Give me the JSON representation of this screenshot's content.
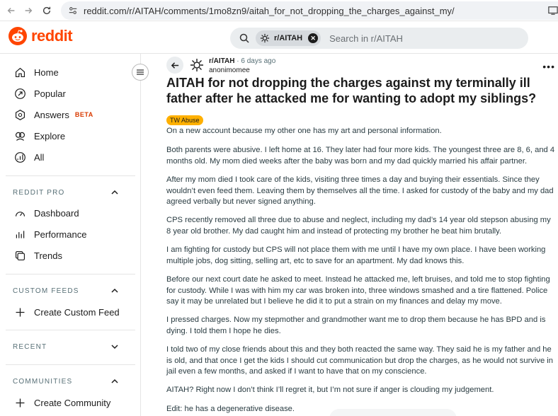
{
  "browser": {
    "url": "reddit.com/r/AITAH/comments/1mo8zn9/aitah_for_not_dropping_the_charges_against_my/"
  },
  "header": {
    "logo_text": "reddit",
    "search_chip": "r/AITAH",
    "search_placeholder": "Search in r/AITAH"
  },
  "sidebar": {
    "main_items": [
      {
        "label": "Home",
        "icon": "home-icon"
      },
      {
        "label": "Popular",
        "icon": "popular-icon"
      },
      {
        "label": "Answers",
        "icon": "answers-icon",
        "badge": "BETA"
      },
      {
        "label": "Explore",
        "icon": "explore-icon"
      },
      {
        "label": "All",
        "icon": "all-icon"
      }
    ],
    "reddit_pro": {
      "title": "REDDIT PRO",
      "items": [
        {
          "label": "Dashboard",
          "icon": "dashboard-icon"
        },
        {
          "label": "Performance",
          "icon": "performance-icon"
        },
        {
          "label": "Trends",
          "icon": "trends-icon"
        }
      ]
    },
    "custom_feeds": {
      "title": "CUSTOM FEEDS",
      "create_label": "Create Custom Feed"
    },
    "recent": {
      "title": "RECENT"
    },
    "communities": {
      "title": "COMMUNITIES",
      "create_label": "Create Community"
    }
  },
  "post": {
    "subreddit": "r/AITAH",
    "time": "6 days ago",
    "author": "anonimomee",
    "title": "AITAH for not dropping the charges against my terminally ill father after he attacked me for wanting to adopt my siblings?",
    "flair": "TW Abuse",
    "flair_color": "#ffb000",
    "paragraphs": [
      "On a new account because my other one has my art and personal information.",
      "Both parents were abusive. I left home at 16. They later had four more kids. The youngest three are 8, 6, and 4 months old. My mom died weeks after the baby was born and my dad quickly married his affair partner.",
      "After my mom died I took care of the kids, visiting three times a day and buying their essentials. Since they wouldn’t even feed them. Leaving them by themselves all the time. I asked for custody of the baby and my dad agreed verbally but never signed anything.",
      "CPS recently removed all three due to abuse and neglect, including my dad’s 14 year old stepson abusing my 8 year old brother. My dad caught him and instead of protecting my brother he beat him brutally.",
      "I am fighting for custody but CPS will not place them with me until I have my own place. I have been working multiple jobs, dog sitting, selling art, etc to save for an apartment. My dad knows this.",
      "Before our next court date he asked to meet. Instead he attacked me, left bruises, and told me to stop fighting for custody. While I was with him my car was broken into, three windows smashed and a tire flattened. Police say it may be unrelated but I believe he did it to put a strain on my finances and delay my move.",
      "I pressed charges. Now my stepmother and grandmother want me to drop them because he has BPD and is dying. I told them I hope he dies.",
      "I told two of my close friends about this and they both reacted the same way. They said he is my father and he is old, and that once I get the kids I should cut communication but drop the charges, as he would not survive in jail even a few months, and asked if I want to have that on my conscience.",
      "AITAH? Right now I don’t think I’ll regret it, but I’m not sure if anger is clouding my judgement.",
      "Edit: he has a degenerative disease."
    ]
  },
  "colors": {
    "brand": "#ff4500",
    "beta": "#d93a00"
  }
}
